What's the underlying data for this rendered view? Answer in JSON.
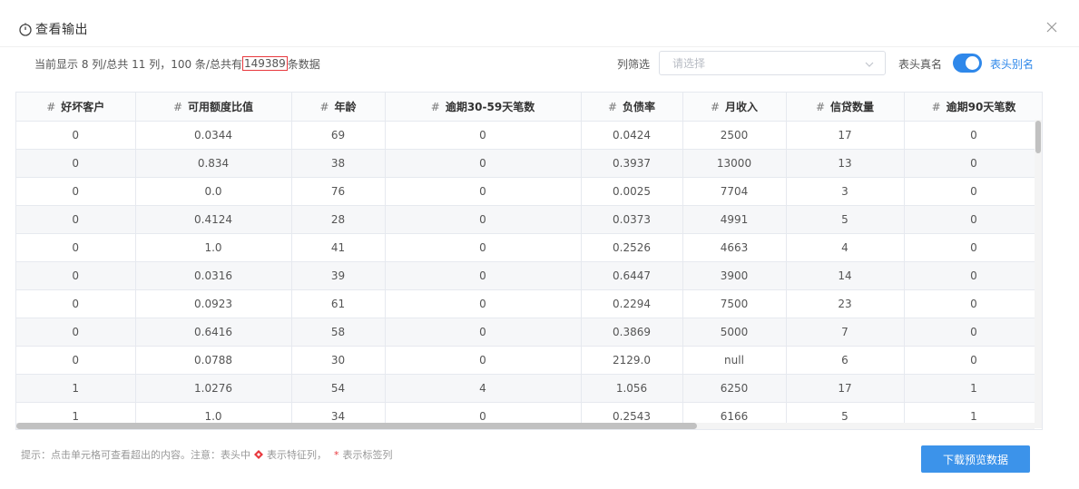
{
  "header": {
    "title": "查看输出",
    "icon": "timer-icon"
  },
  "summary": {
    "prefix": "当前显示 8 列/总共 11 列，100 条/总共有",
    "total": "149389",
    "suffix": "条数据"
  },
  "filter": {
    "label": "列筛选",
    "placeholder": "请选择"
  },
  "toggle": {
    "left_label": "表头真名",
    "right_label": "表头别名",
    "on": true
  },
  "table": {
    "columns": [
      "好坏客户",
      "可用额度比值",
      "年龄",
      "逾期30-59天笔数",
      "负债率",
      "月收入",
      "信贷数量",
      "逾期90天笔数"
    ],
    "column_prefix": "#",
    "rows": [
      [
        "0",
        "0.0344",
        "69",
        "0",
        "0.0424",
        "2500",
        "17",
        "0"
      ],
      [
        "0",
        "0.834",
        "38",
        "0",
        "0.3937",
        "13000",
        "13",
        "0"
      ],
      [
        "0",
        "0.0",
        "76",
        "0",
        "0.0025",
        "7704",
        "3",
        "0"
      ],
      [
        "0",
        "0.4124",
        "28",
        "0",
        "0.0373",
        "4991",
        "5",
        "0"
      ],
      [
        "0",
        "1.0",
        "41",
        "0",
        "0.2526",
        "4663",
        "4",
        "0"
      ],
      [
        "0",
        "0.0316",
        "39",
        "0",
        "0.6447",
        "3900",
        "14",
        "0"
      ],
      [
        "0",
        "0.0923",
        "61",
        "0",
        "0.2294",
        "7500",
        "23",
        "0"
      ],
      [
        "0",
        "0.6416",
        "58",
        "0",
        "0.3869",
        "5000",
        "7",
        "0"
      ],
      [
        "0",
        "0.0788",
        "30",
        "0",
        "2129.0",
        "null",
        "6",
        "0"
      ],
      [
        "1",
        "1.0276",
        "54",
        "4",
        "1.056",
        "6250",
        "17",
        "1"
      ],
      [
        "1",
        "1.0",
        "34",
        "0",
        "0.2543",
        "6166",
        "5",
        "1"
      ]
    ]
  },
  "footer": {
    "hint_part1": "提示：点击单元格可查看超出的内容。注意：表头中",
    "hint_part2": "表示特征列，",
    "hint_star": "*",
    "hint_part3": "表示标签列",
    "download_label": "下载预览数据"
  },
  "colors": {
    "accent": "#2f88ea",
    "button": "#3c93ea",
    "highlight": "#e8383d",
    "stripe": "#f6f7f9"
  }
}
